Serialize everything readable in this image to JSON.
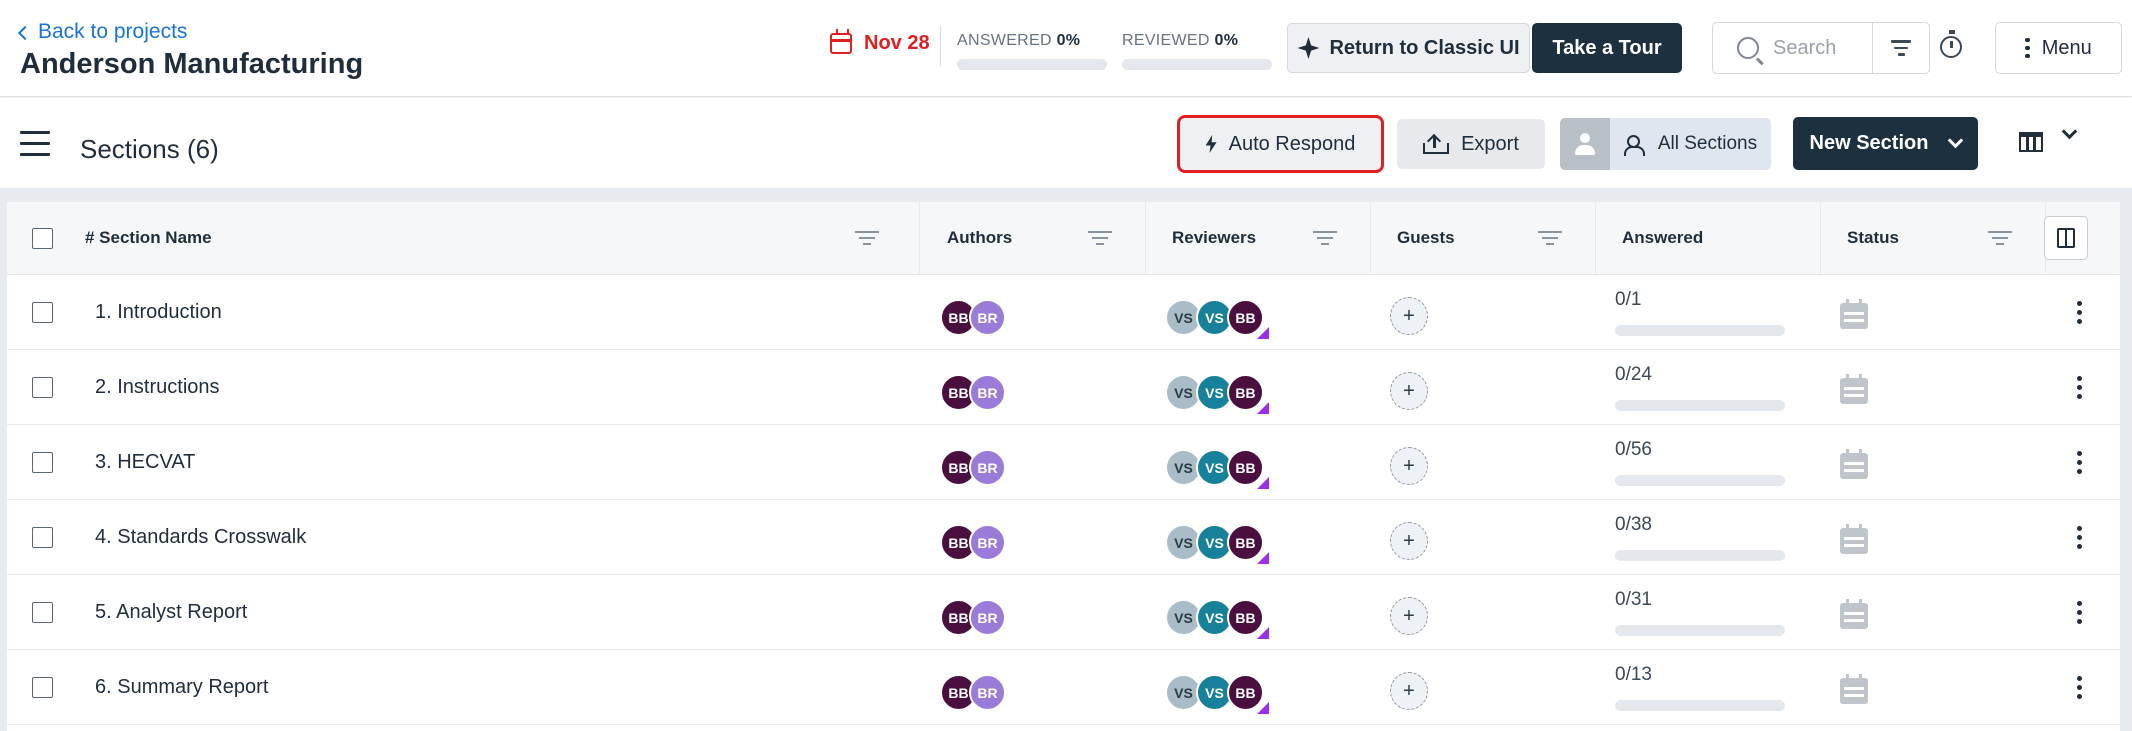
{
  "header": {
    "back_label": "Back to projects",
    "project_title": "Anderson Manufacturing",
    "due_date": "Nov 28",
    "answered_label": "ANSWERED",
    "answered_pct": "0%",
    "reviewed_label": "REVIEWED",
    "reviewed_pct": "0%",
    "classic_ui_label": "Return to Classic UI",
    "tour_label": "Take a Tour",
    "search_placeholder": "Search",
    "menu_label": "Menu"
  },
  "toolbar": {
    "sections_title": "Sections (6)",
    "auto_respond_label": "Auto Respond",
    "export_label": "Export",
    "all_sections_label": "All Sections",
    "new_section_label": "New Section"
  },
  "table": {
    "columns": {
      "name": "# Section Name",
      "authors": "Authors",
      "reviewers": "Reviewers",
      "guests": "Guests",
      "answered": "Answered",
      "status": "Status"
    },
    "rows": [
      {
        "name": "1. Introduction",
        "authors": [
          "BB",
          "BR"
        ],
        "reviewers": [
          "VS",
          "VS",
          "BB"
        ],
        "guests": "+",
        "answered": "0/1"
      },
      {
        "name": "2. Instructions",
        "authors": [
          "BB",
          "BR"
        ],
        "reviewers": [
          "VS",
          "VS",
          "BB"
        ],
        "guests": "+",
        "answered": "0/24"
      },
      {
        "name": "3. HECVAT",
        "authors": [
          "BB",
          "BR"
        ],
        "reviewers": [
          "VS",
          "VS",
          "BB"
        ],
        "guests": "+",
        "answered": "0/56"
      },
      {
        "name": "4. Standards Crosswalk",
        "authors": [
          "BB",
          "BR"
        ],
        "reviewers": [
          "VS",
          "VS",
          "BB"
        ],
        "guests": "+",
        "answered": "0/38"
      },
      {
        "name": "5. Analyst Report",
        "authors": [
          "BB",
          "BR"
        ],
        "reviewers": [
          "VS",
          "VS",
          "BB"
        ],
        "guests": "+",
        "answered": "0/31"
      },
      {
        "name": "6. Summary Report",
        "authors": [
          "BB",
          "BR"
        ],
        "reviewers": [
          "VS",
          "VS",
          "BB"
        ],
        "guests": "+",
        "answered": "0/13"
      }
    ]
  },
  "colors": {
    "primary_dark": "#1c3040",
    "link": "#1a73d9",
    "due_red": "#e02020",
    "highlight_outline": "#e02020",
    "avatar_bb": "#4a0f3f",
    "avatar_br": "#9a7bd8",
    "avatar_vs_light": "#a9bcc8",
    "avatar_vs_teal": "#17809a"
  },
  "icons": {
    "back": "chevron-left-icon",
    "due": "calendar-icon",
    "classic_ui": "sparkle-icon",
    "search": "search-icon",
    "filter": "filter-icon",
    "timer": "timer-icon",
    "menu": "kebab-icon",
    "sidebar": "hamburger-icon",
    "auto_respond": "bolt-icon",
    "export": "upload-icon",
    "all_sections": "users-icon",
    "view": "columns-icon",
    "status": "calendar-status-icon"
  }
}
